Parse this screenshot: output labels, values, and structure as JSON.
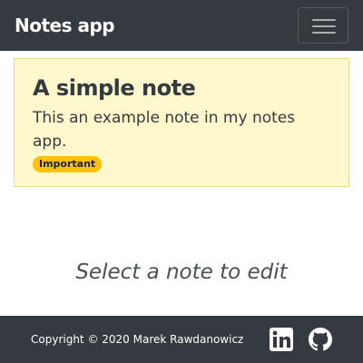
{
  "navbar": {
    "brand": "Notes app",
    "toggle_icon": "hamburger-menu-icon"
  },
  "note": {
    "title": "A simple note",
    "body": "This an example note in my notes app.",
    "badge": "Important",
    "background_color": "#fff8cc",
    "badge_color": "#ffc107"
  },
  "main": {
    "placeholder": "Select a note to edit"
  },
  "footer": {
    "copyright": "Copyright © 2020 Marek Rawdanowicz",
    "social_icons": [
      "linkedin-icon",
      "github-icon"
    ]
  },
  "colors": {
    "bar_background": "#343a40",
    "text_on_dark": "#ffffff"
  }
}
